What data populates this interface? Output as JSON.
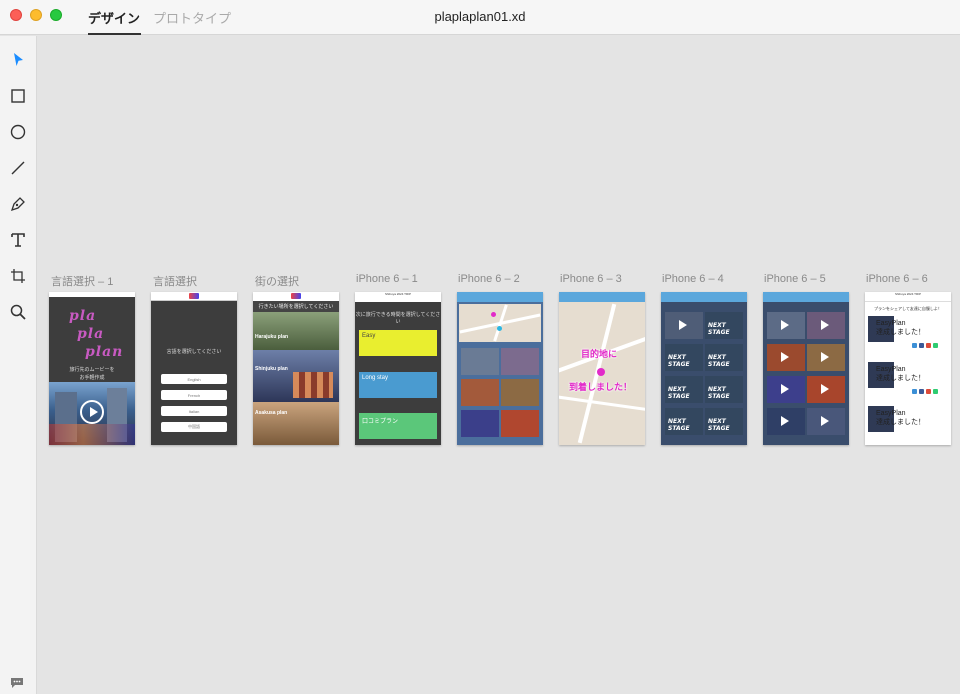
{
  "window": {
    "title": "plaplaplan01.xd",
    "tabs": [
      "デザイン",
      "プロトタイプ"
    ]
  },
  "toolbar": {
    "tools": [
      "select-icon",
      "rectangle-icon",
      "ellipse-icon",
      "line-icon",
      "pen-icon",
      "text-icon",
      "artboard-icon",
      "zoom-icon"
    ],
    "feedback": "feedback-icon"
  },
  "artboards": [
    {
      "label": "言語選択 – 1"
    },
    {
      "label": "言語選択"
    },
    {
      "label": "街の選択"
    },
    {
      "label": "iPhone 6 – 1"
    },
    {
      "label": "iPhone 6 – 2"
    },
    {
      "label": "iPhone 6 – 3"
    },
    {
      "label": "iPhone 6 – 4"
    },
    {
      "label": "iPhone 6 – 5"
    },
    {
      "label": "iPhone 6 – 6"
    }
  ],
  "screens": {
    "s1": {
      "logo": [
        "pla",
        "pla",
        "plan"
      ],
      "caption": [
        "旅行先のムービーを",
        "お手軽作成"
      ]
    },
    "s2": {
      "prompt": "言語を選択してください",
      "langs": [
        "English",
        "French",
        "Italian",
        "中国語"
      ]
    },
    "s3": {
      "header": "行きたい場所を選択してください",
      "cities": [
        "Harajuku plan",
        "Shinjuku plan",
        "Asakusa plan"
      ]
    },
    "s4": {
      "header": "Shibuya 2024 TRIP",
      "prompt": "次に旅行できる時間を選択してください",
      "plans": [
        "Easy",
        "Long stay",
        "口コミプラン"
      ]
    },
    "s6": {
      "arrival": [
        "目的地に",
        "到着しました！"
      ]
    },
    "s7": {
      "tile": "NEXT STAGE"
    },
    "s9": {
      "header": "Shibuya 2024 TRIP",
      "share": "プランをシェアして友達に自慢しよ！",
      "item": [
        "EasyPlan",
        "達成しました！"
      ]
    }
  },
  "colors": {
    "easy": "#e9ee2f",
    "longstay": "#4a9bd0",
    "kuchikomi": "#5bc77a",
    "accent": "#e22ac9"
  }
}
